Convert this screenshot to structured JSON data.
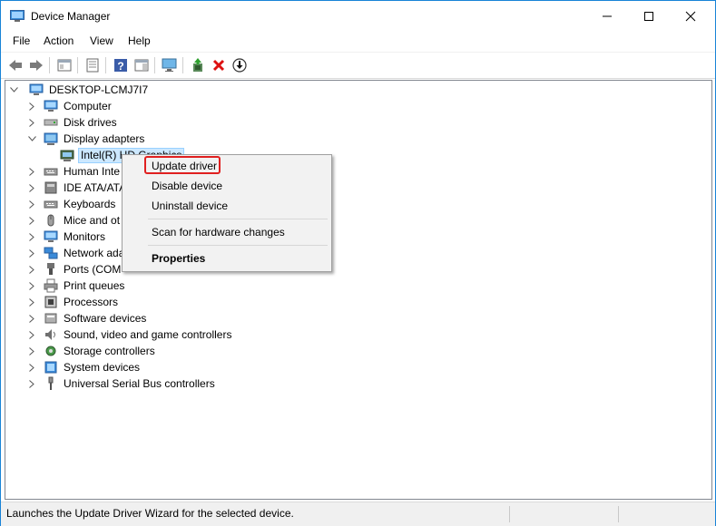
{
  "window": {
    "title": "Device Manager"
  },
  "menubar": {
    "items": [
      "File",
      "Action",
      "View",
      "Help"
    ]
  },
  "toolbar": {
    "buttons": [
      "back-icon",
      "forward-icon",
      "properties-view-icon",
      "device-list-icon",
      "help-icon",
      "details-pane-icon",
      "monitor-scan-icon",
      "update-driver-icon",
      "uninstall-icon",
      "download-icon"
    ]
  },
  "tree": {
    "root": "DESKTOP-LCMJ7I7",
    "categories": [
      {
        "label": "Computer",
        "icon": "computer-icon",
        "expanded": false
      },
      {
        "label": "Disk drives",
        "icon": "disk-icon",
        "expanded": false
      },
      {
        "label": "Display adapters",
        "icon": "display-adapter-icon",
        "expanded": true,
        "children": [
          {
            "label": "Intel(R) HD Graphics",
            "icon": "display-adapter-icon",
            "selected": true
          }
        ]
      },
      {
        "label": "Human Inte",
        "icon": "keyboard-icon",
        "expanded": false
      },
      {
        "label": "IDE ATA/ATA",
        "icon": "ide-icon",
        "expanded": false
      },
      {
        "label": "Keyboards",
        "icon": "keyboard-icon",
        "expanded": false
      },
      {
        "label": "Mice and ot",
        "icon": "mouse-icon",
        "expanded": false
      },
      {
        "label": "Monitors",
        "icon": "monitor-icon",
        "expanded": false
      },
      {
        "label": "Network ada",
        "icon": "network-icon",
        "expanded": false
      },
      {
        "label": "Ports (COM",
        "icon": "port-icon",
        "expanded": false
      },
      {
        "label": "Print queues",
        "icon": "printer-icon",
        "expanded": false
      },
      {
        "label": "Processors",
        "icon": "processor-icon",
        "expanded": false
      },
      {
        "label": "Software devices",
        "icon": "software-icon",
        "expanded": false
      },
      {
        "label": "Sound, video and game controllers",
        "icon": "sound-icon",
        "expanded": false
      },
      {
        "label": "Storage controllers",
        "icon": "storage-icon",
        "expanded": false
      },
      {
        "label": "System devices",
        "icon": "system-icon",
        "expanded": false
      },
      {
        "label": "Universal Serial Bus controllers",
        "icon": "usb-icon",
        "expanded": false
      }
    ]
  },
  "context_menu": {
    "update_driver": "Update driver",
    "disable_device": "Disable device",
    "uninstall_device": "Uninstall device",
    "scan": "Scan for hardware changes",
    "properties": "Properties"
  },
  "statusbar": {
    "text": "Launches the Update Driver Wizard for the selected device."
  },
  "colors": {
    "accent": "#1883d7",
    "selection": "#cce8ff",
    "highlight_border": "#e02020"
  }
}
